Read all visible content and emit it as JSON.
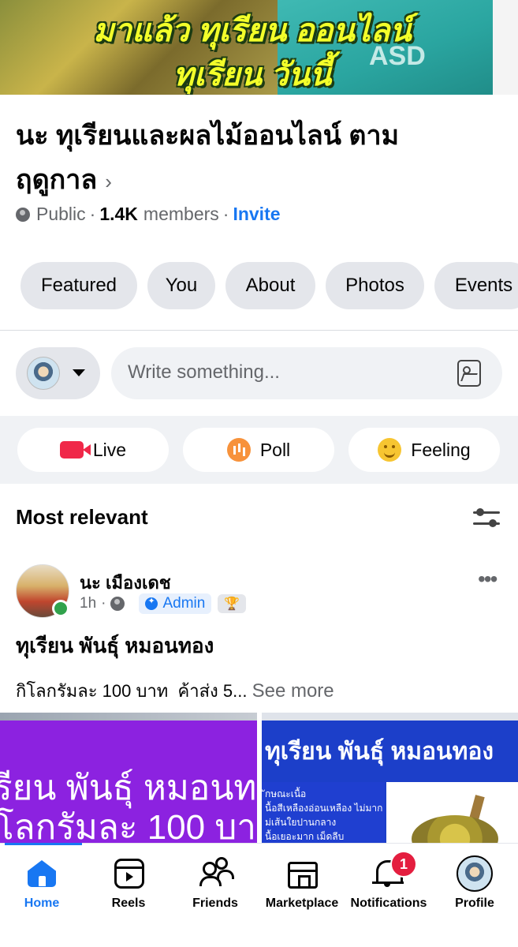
{
  "cover": {
    "line1": "มาแล้ว ทุเรียน ออนไลน์",
    "line2": "ทุเรียน วันนี้",
    "shirt_text": "ASD"
  },
  "group": {
    "title": "นะ ทุเรียนและผลไม้ออนไลน์ ตามฤดูกาล",
    "chevron": "›",
    "privacy": "Public",
    "member_count": "1.4K",
    "members_label": "members",
    "invite": "Invite",
    "separator": "·"
  },
  "tabs": [
    {
      "label": "Featured"
    },
    {
      "label": "You"
    },
    {
      "label": "About"
    },
    {
      "label": "Photos"
    },
    {
      "label": "Events"
    }
  ],
  "composer": {
    "placeholder": "Write something..."
  },
  "actions": [
    {
      "label": "Live",
      "color": "#f02849"
    },
    {
      "label": "Poll",
      "color": "#f7923b"
    },
    {
      "label": "Feeling",
      "color": "#f7c531"
    }
  ],
  "feed": {
    "title": "Most relevant"
  },
  "post": {
    "author": "นะ เมืองเดช",
    "time": "1h",
    "role": "Admin",
    "heading": "ทุเรียน พันธุ์ หมอนทอง",
    "body": "กิโลกรัมละ 100 บาท  ค้าส่ง 5...",
    "see_more": "See more",
    "image1_line1": "รียน พันธุ์ หมอนท",
    "image1_line2": "ิโลกรัมละ 100 บา",
    "image2_title": "ทุเรียน พันธุ์ หมอนทอง",
    "image2_lines": [
      "ักษณะเนื้อ",
      "นื้อสีเหลืองอ่อนเหลือง ไม่มาก",
      "ม่เส้นใยปานกลาง",
      "นื้อเยอะมาก เม็ดลีบ"
    ]
  },
  "bottom_nav": [
    {
      "label": "Home",
      "active": true
    },
    {
      "label": "Reels"
    },
    {
      "label": "Friends"
    },
    {
      "label": "Marketplace"
    },
    {
      "label": "Notifications",
      "badge": "1"
    },
    {
      "label": "Profile"
    }
  ],
  "colors": {
    "accent": "#1877f2",
    "badge": "#e41e3f",
    "online": "#31a24c"
  }
}
